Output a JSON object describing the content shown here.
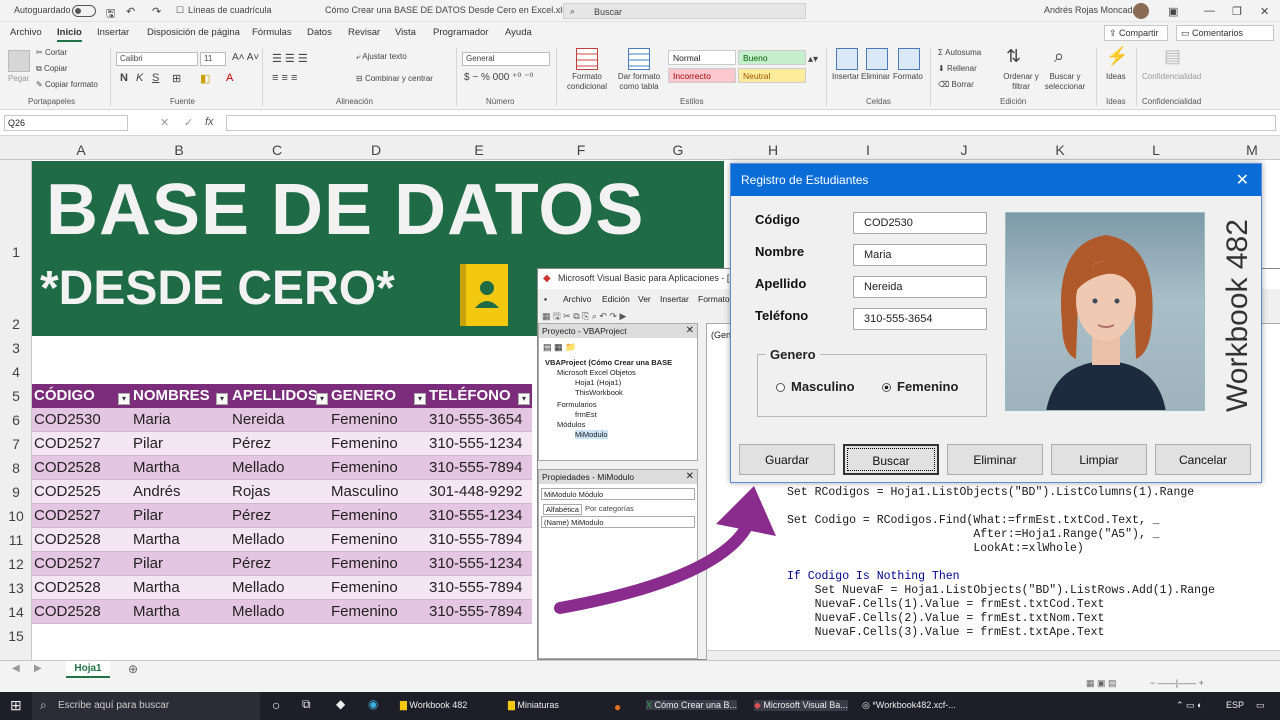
{
  "titlebar": {
    "autosave": "Autoguardado",
    "gridlines": "Líneas de cuadrícula",
    "doc_title": "Cómo Crear una BASE DE DATOS Desde Cero en Excel.xlsm",
    "search": "Buscar",
    "user": "Andrés Rojas Moncada"
  },
  "menu": {
    "items": [
      "Archivo",
      "Inicio",
      "Insertar",
      "Disposición de página",
      "Fórmulas",
      "Datos",
      "Revisar",
      "Vista",
      "Programador",
      "Ayuda"
    ],
    "share": "Compartir",
    "comments": "Comentarios"
  },
  "ribbon": {
    "paste": "Pegar",
    "cut": "Cortar",
    "copy": "Copiar",
    "format_painter": "Copiar formato",
    "clipboard": "Portapapeles",
    "font_name": "Calibri",
    "font_size": "11",
    "font": "Fuente",
    "wrap": "Ajustar texto",
    "merge": "Combinar y centrar",
    "alignment": "Alineación",
    "number_format": "General",
    "number": "Número",
    "cond_format": "Formato condicional",
    "format_table": "Dar formato como tabla",
    "style_normal": "Normal",
    "style_good": "Bueno",
    "style_bad": "Incorrecto",
    "style_neutral": "Neutral",
    "styles": "Estilos",
    "insert": "Insertar",
    "delete": "Eliminar",
    "format": "Formato",
    "cells": "Celdas",
    "autosum": "Autosuma",
    "fill": "Rellenar",
    "clear": "Borrar",
    "sort": "Ordenar y filtrar",
    "find": "Buscar y seleccionar",
    "editing": "Edición",
    "ideas": "Ideas",
    "confidentiality": "Confidencialidad"
  },
  "formula_bar": {
    "cell": "Q26",
    "content": ""
  },
  "columns": [
    "A",
    "B",
    "C",
    "D",
    "E",
    "F",
    "G",
    "H",
    "I",
    "J",
    "K",
    "L",
    "M"
  ],
  "rows": [
    "1",
    "2",
    "3",
    "4",
    "5",
    "6",
    "7",
    "8",
    "9",
    "10",
    "11",
    "12",
    "13",
    "14",
    "15"
  ],
  "banner": {
    "title": "BASE DE DATOS",
    "subtitle": "*DESDE CERO*"
  },
  "table": {
    "headers": [
      "CÓDIGO",
      "NOMBRES",
      "APELLIDOS",
      "GENERO",
      "TELÉFONO"
    ],
    "rows": [
      [
        "COD2530",
        "Maria",
        "Nereida",
        "Femenino",
        "310-555-3654"
      ],
      [
        "COD2527",
        "Pilar",
        "Pérez",
        "Femenino",
        "310-555-1234"
      ],
      [
        "COD2528",
        "Martha",
        "Mellado",
        "Femenino",
        "310-555-7894"
      ],
      [
        "COD2525",
        "Andrés",
        "Rojas",
        "Masculino",
        "301-448-9292"
      ],
      [
        "COD2527",
        "Pilar",
        "Pérez",
        "Femenino",
        "310-555-1234"
      ],
      [
        "COD2528",
        "Martha",
        "Mellado",
        "Femenino",
        "310-555-7894"
      ],
      [
        "COD2527",
        "Pilar",
        "Pérez",
        "Femenino",
        "310-555-1234"
      ],
      [
        "COD2528",
        "Martha",
        "Mellado",
        "Femenino",
        "310-555-7894"
      ],
      [
        "COD2528",
        "Martha",
        "Mellado",
        "Femenino",
        "310-555-7894"
      ]
    ]
  },
  "sheet_tab": "Hoja1",
  "vba": {
    "title": "Microsoft Visual Basic para Aplicaciones - [MiModulo",
    "menu": [
      "Archivo",
      "Edición",
      "Ver",
      "Insertar",
      "Formato"
    ],
    "project_title": "Proyecto - VBAProject",
    "tree": [
      "VBAProject (Cómo Crear una BASE",
      "Microsoft Excel Objetos",
      "Hoja1 (Hoja1)",
      "ThisWorkbook",
      "Formularios",
      "frmEst",
      "Módulos",
      "MiModulo"
    ],
    "props_title": "Propiedades - MiModulo",
    "props_combo": "MiModulo  Módulo",
    "props_tab1": "Alfabética",
    "props_tab2": "Por categorías",
    "props_name": "(Name)  MiModulo",
    "code_header": "(Gen",
    "code": [
      "Set RCodigos = Hoja1.ListObjects(\"BD\").ListColumns(1).Range",
      "",
      "Set Codigo = RCodigos.Find(What:=frmEst.txtCod.Text, _",
      "                           After:=Hoja1.Range(\"A5\"), _",
      "                           LookAt:=xlWhole)",
      "",
      "If Codigo Is Nothing Then",
      "    Set NuevaF = Hoja1.ListObjects(\"BD\").ListRows.Add(1).Range",
      "    NuevaF.Cells(1).Value = frmEst.txtCod.Text",
      "    NuevaF.Cells(2).Value = frmEst.txtNom.Text",
      "    NuevaF.Cells(3).Value = frmEst.txtApe.Text"
    ]
  },
  "form": {
    "title": "Registro de Estudiantes",
    "labels": {
      "codigo": "Código",
      "nombre": "Nombre",
      "apellido": "Apellido",
      "telefono": "Teléfono"
    },
    "values": {
      "codigo": "COD2530",
      "nombre": "Maria",
      "apellido": "Nereida",
      "telefono": "310-555-3654"
    },
    "genero": "Genero",
    "masculino": "Masculino",
    "femenino": "Femenino",
    "selected_gender": "Femenino",
    "buttons": [
      "Guardar",
      "Buscar",
      "Eliminar",
      "Limpiar",
      "Cancelar"
    ],
    "watermark": "Workbook 482"
  },
  "taskbar": {
    "search": "Escribe aquí para buscar",
    "items": [
      "Workbook 482",
      "Miniaturas",
      "Cómo Crear una B...",
      "Microsoft Visual Ba...",
      "*Workbook482.xcf-..."
    ],
    "lang": "ESP"
  },
  "colors": {
    "excel_green": "#1e6b45",
    "table_header": "#7b2c7b",
    "arrow": "#8a2b8e",
    "form_title": "#0a6cd6"
  }
}
